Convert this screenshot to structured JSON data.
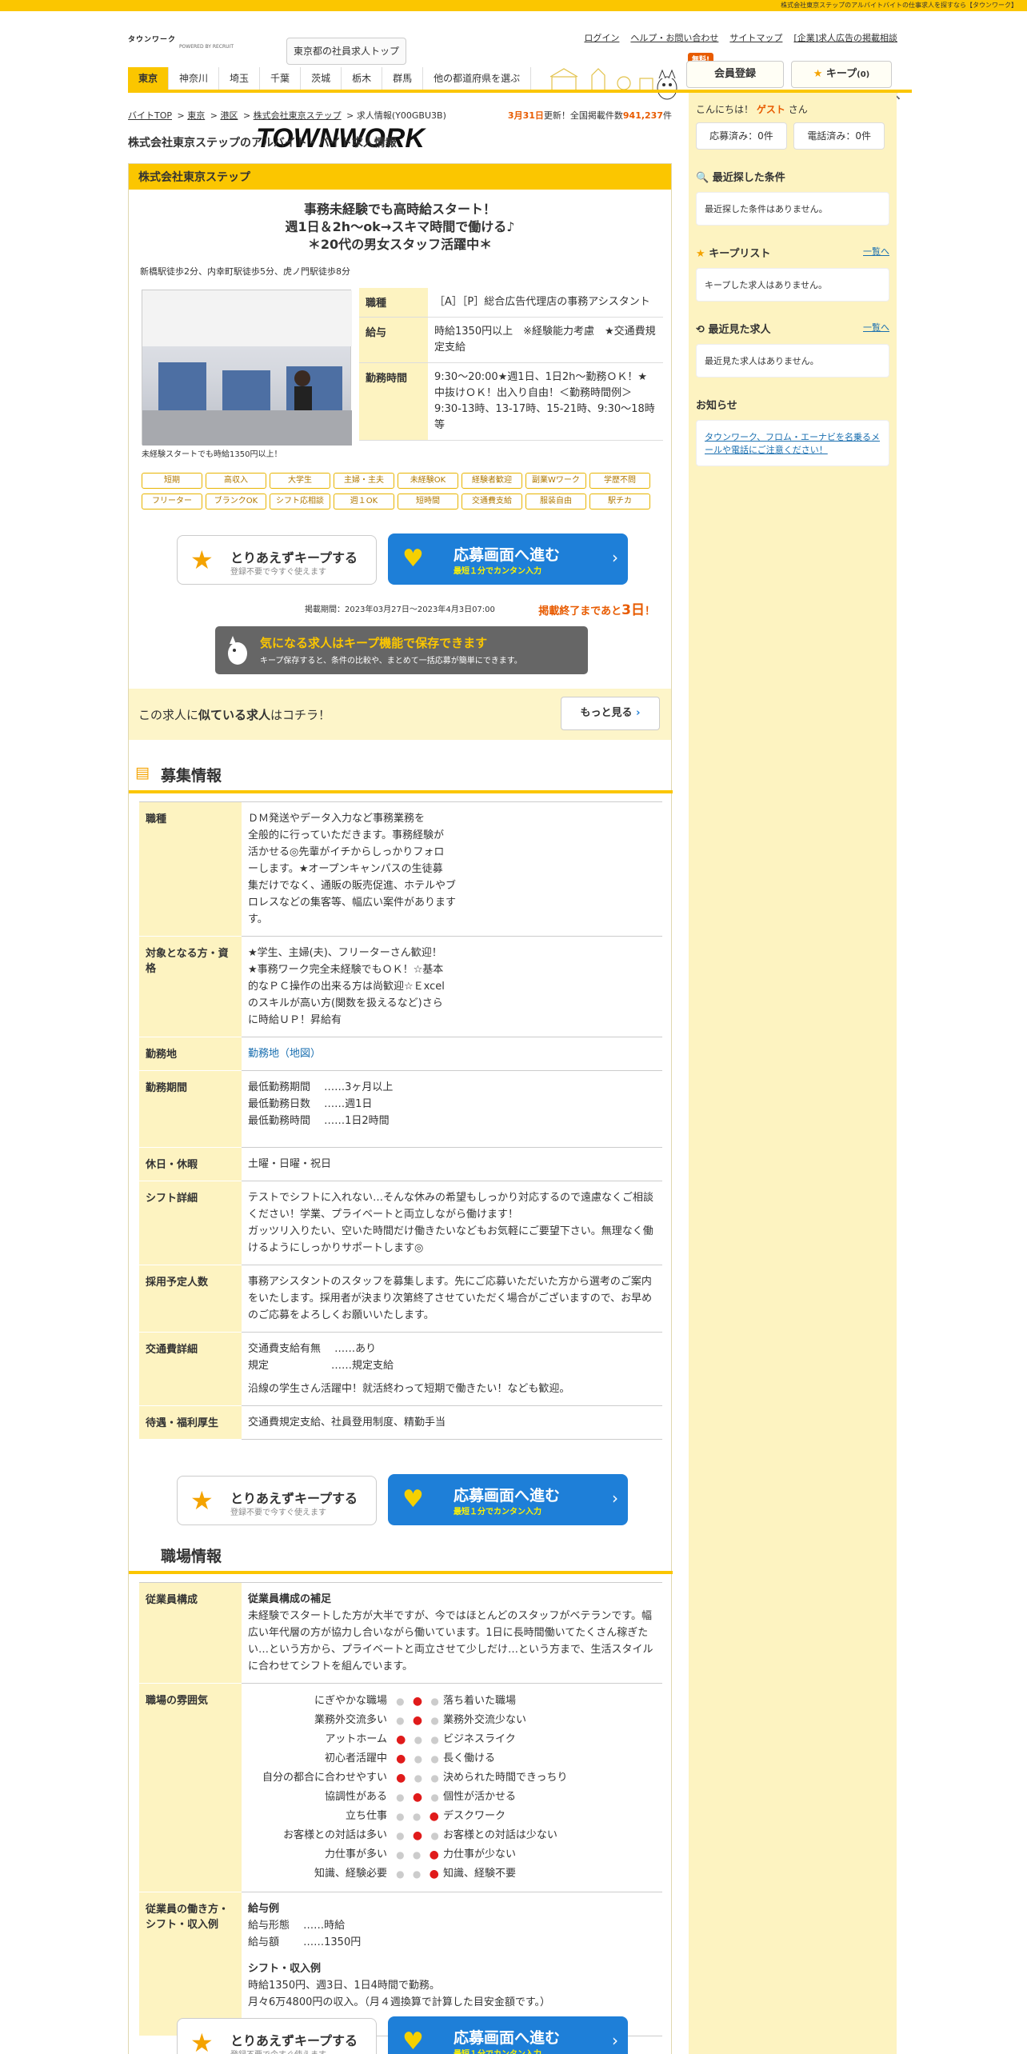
{
  "topbar": {
    "text": "株式会社東京ステップのアルバイトバイトの仕事求人を探すなら【タウンワーク】"
  },
  "header": {
    "logo_sub": "タウンワーク",
    "logo_main": "TOWNWORK",
    "logo_powered": "POWERED BY RECRUIT",
    "tokyo_btn": "東京都の社員求人トップ",
    "links": [
      "ログイン",
      "ヘルプ・お問い合わせ",
      "サイトマップ",
      "[企業]求人広告の掲載相談"
    ],
    "free_badge": "無料!",
    "member_btn": "会員登録",
    "keep_btn": "キープ",
    "keep_count": "(0)"
  },
  "prefs": [
    "東京",
    "神奈川",
    "埼玉",
    "千葉",
    "茨城",
    "栃木",
    "群馬",
    "他の都道府県を選ぶ"
  ],
  "breadcrumb": [
    "バイトTOP",
    "東京",
    "港区",
    "株式会社東京ステップ",
    "求人情報(Y00GBU3B)"
  ],
  "update": {
    "date": "3月31日",
    "text1": "更新！全国掲載件数",
    "count": "941,237",
    "unit": "件"
  },
  "page_title": "株式会社東京ステップのアルバイト・バイト求人情報",
  "job": {
    "company": "株式会社東京ステップ",
    "catch": [
      "事務未経験でも高時給スタート！",
      "週1日＆2h～ok→スキマ時間で働ける♪",
      "＊20代の男女スタッフ活躍中＊"
    ],
    "access": "新橋駅徒歩2分、内幸町駅徒歩5分、虎ノ門駅徒歩8分",
    "photo_caption": "未経験スタートでも時給1350円以上！",
    "summary": [
      {
        "k": "職種",
        "v": "［A］［P］総合広告代理店の事務アシスタント"
      },
      {
        "k": "給与",
        "v": "時給1350円以上　※経験能力考慮　★交通費規定支給"
      },
      {
        "k": "勤務時間",
        "v": "9:30～20:00★週1日、1日2h～勤務ＯＫ！★中抜けＯＫ！出入り自由！＜勤務時間例＞9:30-13時、13-17時、15-21時、9:30～18時　等"
      }
    ],
    "tags": [
      "短期",
      "高収入",
      "大学生",
      "主婦・主夫",
      "未経験OK",
      "経験者歓迎",
      "副業Wワーク",
      "学歴不問",
      "フリーター",
      "ブランクOK",
      "シフト応相談",
      "週１OK",
      "短時間",
      "交通費支給",
      "服装自由",
      "駅チカ"
    ],
    "keep_label": "とりあえずキープする",
    "keep_sub": "登録不要で今すぐ使えます",
    "apply_label": "応募画面へ進む",
    "apply_sub": "最短１分でカンタン入力",
    "period": "掲載期間：2023年03月27日～2023年4月3日07:00",
    "deadline_pre": "掲載終了まであと",
    "deadline_num": "3日",
    "deadline_post": "！",
    "keep_banner_t1": "気になる求人はキープ機能で保存できます",
    "keep_banner_t2": "キープ保存すると、条件の比較や、まとめて一括応募が簡単にできます。",
    "similar_text1": "この求人に",
    "similar_text2": "似ている求人",
    "similar_text3": "はコチラ！",
    "similar_btn": "もっと見る"
  },
  "recruit": {
    "title": "募集情報",
    "rows": [
      {
        "k": "職種",
        "v": [
          "ＤＭ発送やデータ入力など事務業務を",
          "全般的に行っていただきます。事務経験が",
          "活かせる◎先輩がイチからしっかりフォロ",
          "ーします。★オープンキャンパスの生徒募",
          "集だけでなく、通販の販売促進、ホテルやブ",
          "ロレスなどの集客等、幅広い案件があります",
          "す。"
        ]
      },
      {
        "k": "対象となる方・資格",
        "v": [
          "★学生、主婦(夫)、フリーターさん歓迎！",
          "★事務ワーク完全未経験でもＯＫ！☆基本",
          "的なＰＣ操作の出来る方は尚歓迎☆Ｅxcel",
          "のスキルが高い方(関数を扱えるなど)さら",
          "に時給ＵＰ！昇給有"
        ]
      },
      {
        "k": "勤務地",
        "v": [
          "勤務地（地図）"
        ]
      },
      {
        "k": "勤務期間",
        "v": [
          "最低勤務期間　 ……3ヶ月以上",
          "最低勤務日数　 ……週1日",
          "最低勤務時間　 ……1日2時間"
        ]
      },
      {
        "k": "休日・休暇",
        "v": [
          "土曜・日曜・祝日"
        ]
      },
      {
        "k": "シフト詳細",
        "v": [
          "テストでシフトに入れない…そんな休みの希望もしっかり対応するので遠慮なくご相談ください！学業、プライベートと両立しながら働けます！",
          "ガッツリ入りたい、空いた時間だけ働きたいなどもお気軽にご要望下さい。無理なく働けるようにしっかりサポートします◎"
        ]
      },
      {
        "k": "採用予定人数",
        "v": [
          "事務アシスタントのスタッフを募集します。先にご応募いただいた方から選考のご案内をいたします。採用者が決まり次第終了させていただく場合がございますので、お早めのご応募をよろしくお願いいたします。"
        ]
      },
      {
        "k": "交通費詳細",
        "v": [
          "交通費支給有無　 ……あり",
          "規定　　　　　　……規定支給",
          "",
          "沿線の学生さん活躍中！就活終わって短期で働きたい！なども歓迎。"
        ]
      },
      {
        "k": "待遇・福利厚生",
        "v": [
          "交通費規定支給、社員登用制度、精勤手当"
        ]
      }
    ]
  },
  "workplace": {
    "title": "職場情報",
    "composition_label": "従業員構成",
    "composition_head": "従業員構成の補足",
    "composition_text": "未経験でスタートした方が大半ですが、今ではほとんどのスタッフがベテランです。幅広い年代層の方が協力し合いながら働いています。1日に長時間働いてたくさん稼ぎたい…という方から、プライベートと両立させて少しだけ…という方まで、生活スタイルに合わせてシフトを組んでいます。",
    "atmos_label": "職場の雰囲気",
    "atmos": [
      {
        "l": "にぎやかな職場",
        "r": "落ち着いた職場",
        "pos": 2
      },
      {
        "l": "業務外交流多い",
        "r": "業務外交流少ない",
        "pos": 2
      },
      {
        "l": "アットホーム",
        "r": "ビジネスライク",
        "pos": 1
      },
      {
        "l": "初心者活躍中",
        "r": "長く働ける",
        "pos": 1
      },
      {
        "l": "自分の都合に合わせやすい",
        "r": "決められた時間できっちり",
        "pos": 1
      },
      {
        "l": "協調性がある",
        "r": "個性が活かせる",
        "pos": 2
      },
      {
        "l": "立ち仕事",
        "r": "デスクワーク",
        "pos": 3
      },
      {
        "l": "お客様との対話は多い",
        "r": "お客様との対話は少ない",
        "pos": 2
      },
      {
        "l": "力仕事が多い",
        "r": "力仕事が少ない",
        "pos": 3
      },
      {
        "l": "知識、経験必要",
        "r": "知識、経験不要",
        "pos": 3
      }
    ],
    "work_label": "従業員の働き方・シフト・収入例",
    "pay_head": "給与例",
    "pay_form": "給与形態　 ……時給",
    "pay_amount": "給与額　　 ……1350円",
    "shift_head": "シフト・収入例",
    "shift_text1": "時給1350円、週3日、1日4時間で勤務。",
    "shift_text2": "月々6万4800円の収入。（月４週換算で計算した目安金額です。）"
  },
  "sidebar": {
    "hello": "こんにちは！",
    "guest": "ゲスト",
    "san": "さん",
    "applied": "応募済み：0件",
    "phoned": "電話済み：0件",
    "recent_cond": "最近探した条件",
    "recent_cond_empty": "最近探した条件はありません。",
    "keeplist": "キープリスト",
    "keeplist_more": "一覧へ",
    "keeplist_empty": "キープした求人はありません。",
    "recent_view": "最近見た求人",
    "recent_view_more": "一覧へ",
    "recent_view_empty": "最近見た求人はありません。",
    "notice": "お知らせ",
    "notice_link": "タウンワーク、フロム・エーナビを名乗るメールや電話にご注意ください！"
  }
}
